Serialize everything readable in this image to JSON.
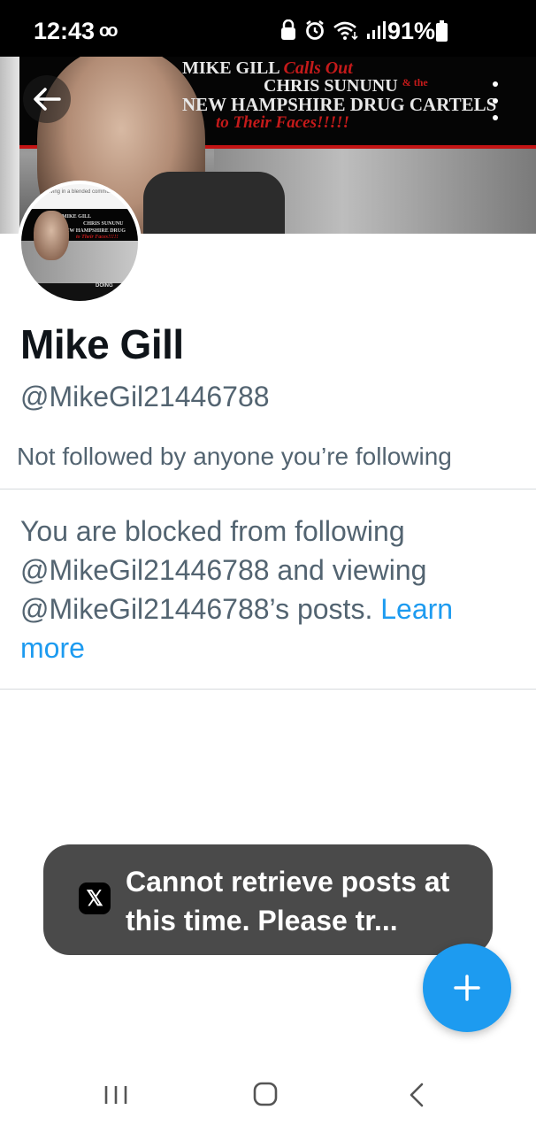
{
  "status_bar": {
    "time": "12:43",
    "voicemail_icon": "voicemail-icon",
    "icons": [
      "lock-icon",
      "alarm-icon",
      "wifi-icon",
      "signal-icon"
    ],
    "battery": "91%"
  },
  "banner": {
    "line1": "MIKE GILL",
    "line1_red": "Calls Out",
    "line2": "CHRIS SUNUNU",
    "line2_small": "& the",
    "line3": "NEW HAMPSHIRE DRUG CARTELS",
    "line4": "to Their Faces!!!!!"
  },
  "avatar": {
    "top_text": "...ving in a blended community. The",
    "line1": "MIKE GILL",
    "line2": "CHRIS SUNUNU",
    "line3": "NEW HAMPSHIRE DRUG",
    "line4": "to Their Faces!!!!!",
    "bottom": "DOING"
  },
  "profile": {
    "name": "Mike Gill",
    "handle": "@MikeGil21446788",
    "followers_note": "Not followed by anyone you’re following"
  },
  "blocked_notice": {
    "text": "You are blocked from following @MikeGil21446788 and viewing @MikeGil21446788’s posts.",
    "link": "Learn more"
  },
  "toast": {
    "icon": "x-logo-icon",
    "icon_glyph": "𝕏",
    "text": "Cannot retrieve posts at this time. Please tr..."
  },
  "fab": {
    "label": "+"
  },
  "colors": {
    "accent": "#1d9bf0",
    "secondary_text": "#536471",
    "toast_bg": "#4a4a4a"
  }
}
